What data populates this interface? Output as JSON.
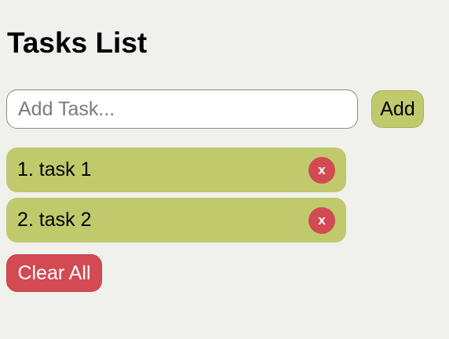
{
  "header": {
    "title": "Tasks List"
  },
  "form": {
    "input_value": "",
    "input_placeholder": "Add Task...",
    "add_label": "Add"
  },
  "tasks": [
    {
      "label": "1. task 1",
      "delete_label": "x"
    },
    {
      "label": "2. task 2",
      "delete_label": "x"
    }
  ],
  "actions": {
    "clear_label": "Clear All"
  },
  "colors": {
    "background": "#f0f0ec",
    "accent_green": "#c0c96b",
    "danger_red": "#d24a52"
  }
}
